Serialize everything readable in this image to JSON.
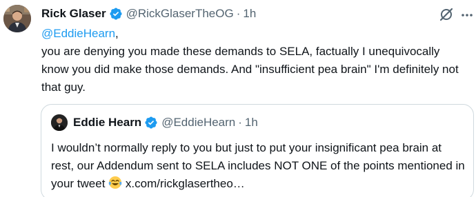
{
  "tweet": {
    "author_name": "Rick Glaser",
    "handle": "@RickGlaserTheOG",
    "separator": "·",
    "time": "1h",
    "mention": "@EddieHearn",
    "mention_suffix": ",",
    "text": "you are denying you made these demands to SELA, factually I unequivocally know you did make those demands. And \"insufficient pea brain\" I'm definitely not that guy."
  },
  "quoted_tweet": {
    "author_name": "Eddie Hearn",
    "handle": "@EddieHearn",
    "separator": "·",
    "time": "1h",
    "text": "I wouldn’t normally reply to you but just to put your insignificant pea brain at rest, our Addendum sent to SELA includes NOT ONE of the points mentioned in your tweet",
    "emoji": "joy-tears-emoji",
    "link": "x.com/rickglasertheo…"
  },
  "colors": {
    "accent": "#1d9bf0",
    "text": "#0f1419",
    "muted": "#536471",
    "border": "#cfd9de"
  },
  "icons": [
    "verified-badge-icon",
    "grok-icon",
    "more-options-icon"
  ]
}
